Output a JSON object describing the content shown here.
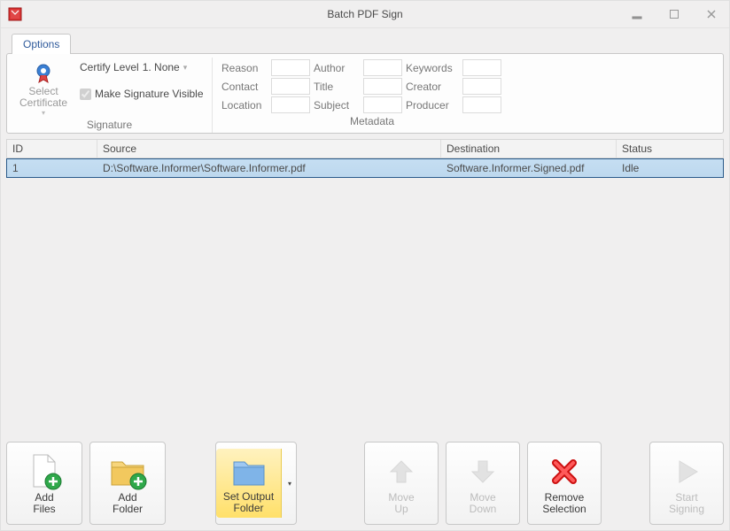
{
  "app": {
    "title": "Batch PDF Sign"
  },
  "tabs": {
    "options": "Options"
  },
  "ribbon": {
    "signature": {
      "groupLabel": "Signature",
      "selectCertificate": "Select\nCertificate",
      "certifyLevelLabel": "Certify Level",
      "certifyLevelValue": "1. None",
      "makeSigVisible": "Make Signature Visible"
    },
    "metaGroupLabel": "Metadata",
    "meta": {
      "reason": "Reason",
      "contact": "Contact",
      "location": "Location",
      "author": "Author",
      "title": "Title",
      "subject": "Subject",
      "keywords": "Keywords",
      "creator": "Creator",
      "producer": "Producer"
    }
  },
  "table": {
    "headers": {
      "id": "ID",
      "source": "Source",
      "destination": "Destination",
      "status": "Status"
    },
    "rows": [
      {
        "id": "1",
        "source": "D:\\Software.Informer\\Software.Informer.pdf",
        "destination": "Software.Informer.Signed.pdf",
        "status": "Idle"
      }
    ]
  },
  "toolbar": {
    "addFiles": "Add\nFiles",
    "addFolder": "Add\nFolder",
    "setOutput": "Set Output\nFolder",
    "moveUp": "Move\nUp",
    "moveDown": "Move\nDown",
    "removeSel": "Remove\nSelection",
    "startSigning": "Start\nSigning"
  }
}
